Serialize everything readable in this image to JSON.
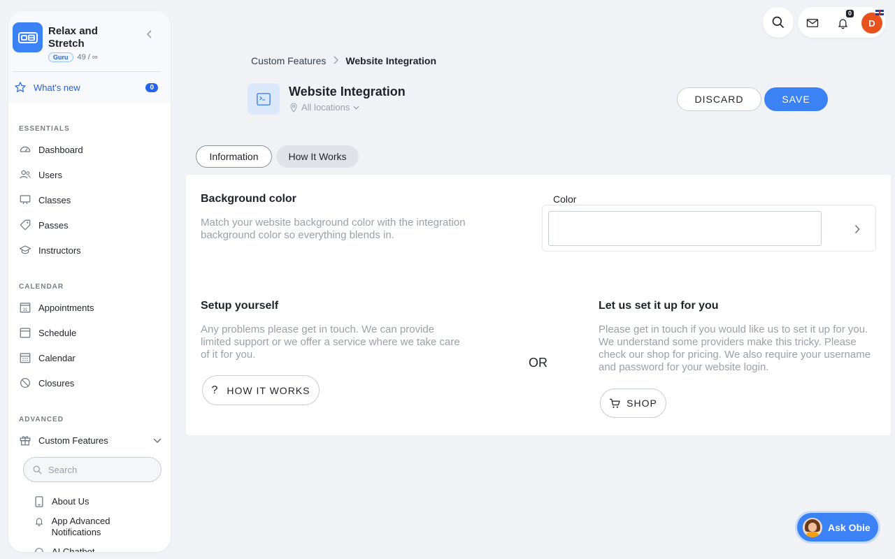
{
  "sidebar": {
    "brand_name": "Relax and Stretch",
    "plan_badge": "Guru",
    "usage": "49 / ∞",
    "whats_new": {
      "label": "What's new",
      "count": "0"
    },
    "sections": {
      "essentials": "ESSENTIALS",
      "calendar": "CALENDAR",
      "advanced": "ADVANCED"
    },
    "essentials_items": [
      "Dashboard",
      "Users",
      "Classes",
      "Passes",
      "Instructors"
    ],
    "calendar_items": [
      "Appointments",
      "Schedule",
      "Calendar",
      "Closures"
    ],
    "advanced_items": [
      "Custom Features"
    ],
    "search_placeholder": "Search",
    "sub_items": [
      "About Us",
      "App Advanced Notifications",
      "AI Chatbot"
    ]
  },
  "topbar": {
    "notification_count": "0",
    "avatar_initial": "D"
  },
  "breadcrumb": {
    "parent": "Custom Features",
    "current": "Website Integration"
  },
  "header": {
    "title": "Website Integration",
    "location": "All locations",
    "discard_label": "DISCARD",
    "save_label": "SAVE"
  },
  "tabs": [
    "Information",
    "How It Works"
  ],
  "card": {
    "bg_title": "Background color",
    "bg_desc": "Match your website background color with the integration background color so everything blends in.",
    "color_label": "Color",
    "color_value": "",
    "setup_title": "Setup yourself",
    "setup_desc": "Any problems please get in touch. We can provide limited support or we offer a service where we take care of it for you.",
    "how_button": "HOW IT WORKS",
    "or": "OR",
    "letus_title": "Let us set it up for you",
    "letus_desc": "Please get in touch if you would like us to set it up for you. We understand some providers make this tricky. Please check our shop for pricing. We also require your username and password for your website login.",
    "shop_button": "SHOP"
  },
  "assistant": {
    "label": "Ask Obie"
  },
  "colors": {
    "accent": "#3b82f6",
    "avatar": "#e8521e",
    "background": "#f0f2f6"
  }
}
